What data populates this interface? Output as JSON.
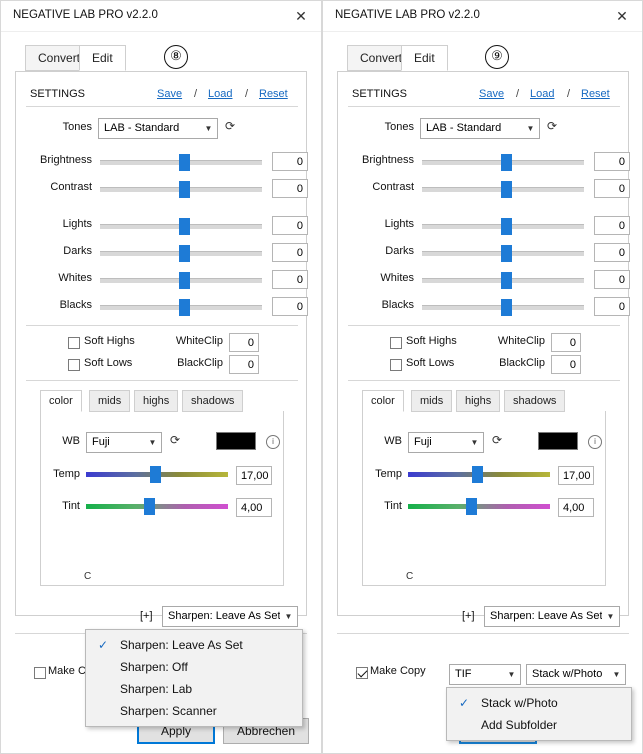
{
  "windows": [
    {
      "title": "NEGATIVE LAB PRO v2.2.0",
      "close_icon": "✕",
      "badge": "⑧",
      "tabs": [
        {
          "label": "Convert",
          "active": false
        },
        {
          "label": "Edit",
          "active": true
        }
      ],
      "settings": {
        "label": "SETTINGS",
        "save": "Save",
        "load": "Load",
        "reset": "Reset",
        "separator": "/"
      },
      "tones": {
        "label": "Tones",
        "value": "LAB - Standard",
        "refresh_icon": "⟳"
      },
      "sliders": [
        {
          "label": "Brightness",
          "value": "0",
          "pos": 50
        },
        {
          "label": "Contrast",
          "value": "0",
          "pos": 50
        },
        {
          "label": "Lights",
          "value": "0",
          "pos": 50
        },
        {
          "label": "Darks",
          "value": "0",
          "pos": 50
        },
        {
          "label": "Whites",
          "value": "0",
          "pos": 50
        },
        {
          "label": "Blacks",
          "value": "0",
          "pos": 50
        }
      ],
      "checks": [
        {
          "label": "Soft Highs",
          "checked": false
        },
        {
          "label": "Soft Lows",
          "checked": false
        }
      ],
      "clips": [
        {
          "label": "WhiteClip",
          "value": "0"
        },
        {
          "label": "BlackClip",
          "value": "0"
        }
      ],
      "color_tabs": [
        {
          "label": "color",
          "active": true
        },
        {
          "label": "mids",
          "active": false
        },
        {
          "label": "highs",
          "active": false
        },
        {
          "label": "shadows",
          "active": false
        }
      ],
      "wb": {
        "label": "WB",
        "value": "Fuji",
        "refresh_icon": "⟳",
        "swatch_color": "#000000",
        "info_icon": "i"
      },
      "color_sliders": [
        {
          "label": "Temp",
          "value": "17,00",
          "pos": 48
        },
        {
          "label": "Tint",
          "value": "4,00",
          "pos": 45
        }
      ],
      "corner_mark": "C",
      "plus_button": "[+]",
      "sharpen": {
        "value": "Sharpen: Leave As Set"
      },
      "make_copy": {
        "label": "Make Copy",
        "checked": false
      },
      "buttons": [
        {
          "label": "Apply",
          "primary": true
        },
        {
          "label": "Abbrechen",
          "primary": false
        }
      ],
      "sharpen_menu": {
        "open": true,
        "items": [
          {
            "label": "Sharpen: Leave As Set",
            "checked": true
          },
          {
            "label": "Sharpen: Off",
            "checked": false
          },
          {
            "label": "Sharpen: Lab",
            "checked": false
          },
          {
            "label": "Sharpen: Scanner",
            "checked": false
          }
        ]
      }
    },
    {
      "title": "NEGATIVE LAB PRO v2.2.0",
      "close_icon": "✕",
      "badge": "⑨",
      "tabs": [
        {
          "label": "Convert",
          "active": false
        },
        {
          "label": "Edit",
          "active": true
        }
      ],
      "settings": {
        "label": "SETTINGS",
        "save": "Save",
        "load": "Load",
        "reset": "Reset",
        "separator": "/"
      },
      "tones": {
        "label": "Tones",
        "value": "LAB - Standard",
        "refresh_icon": "⟳"
      },
      "sliders": [
        {
          "label": "Brightness",
          "value": "0",
          "pos": 50
        },
        {
          "label": "Contrast",
          "value": "0",
          "pos": 50
        },
        {
          "label": "Lights",
          "value": "0",
          "pos": 50
        },
        {
          "label": "Darks",
          "value": "0",
          "pos": 50
        },
        {
          "label": "Whites",
          "value": "0",
          "pos": 50
        },
        {
          "label": "Blacks",
          "value": "0",
          "pos": 50
        }
      ],
      "checks": [
        {
          "label": "Soft Highs",
          "checked": false
        },
        {
          "label": "Soft Lows",
          "checked": false
        }
      ],
      "clips": [
        {
          "label": "WhiteClip",
          "value": "0"
        },
        {
          "label": "BlackClip",
          "value": "0"
        }
      ],
      "color_tabs": [
        {
          "label": "color",
          "active": true
        },
        {
          "label": "mids",
          "active": false
        },
        {
          "label": "highs",
          "active": false
        },
        {
          "label": "shadows",
          "active": false
        }
      ],
      "wb": {
        "label": "WB",
        "value": "Fuji",
        "refresh_icon": "⟳",
        "swatch_color": "#000000",
        "info_icon": "i"
      },
      "color_sliders": [
        {
          "label": "Temp",
          "value": "17,00",
          "pos": 48
        },
        {
          "label": "Tint",
          "value": "4,00",
          "pos": 45
        }
      ],
      "corner_mark": "C",
      "plus_button": "[+]",
      "sharpen": {
        "value": "Sharpen: Leave As Set"
      },
      "make_copy": {
        "label": "Make Copy",
        "checked": true
      },
      "format": {
        "value": "TIF"
      },
      "stack": {
        "value": "Stack w/Photo"
      },
      "stack_menu": {
        "open": true,
        "items": [
          {
            "label": "Stack w/Photo",
            "checked": true
          },
          {
            "label": "Add Subfolder",
            "checked": false
          }
        ]
      }
    }
  ]
}
